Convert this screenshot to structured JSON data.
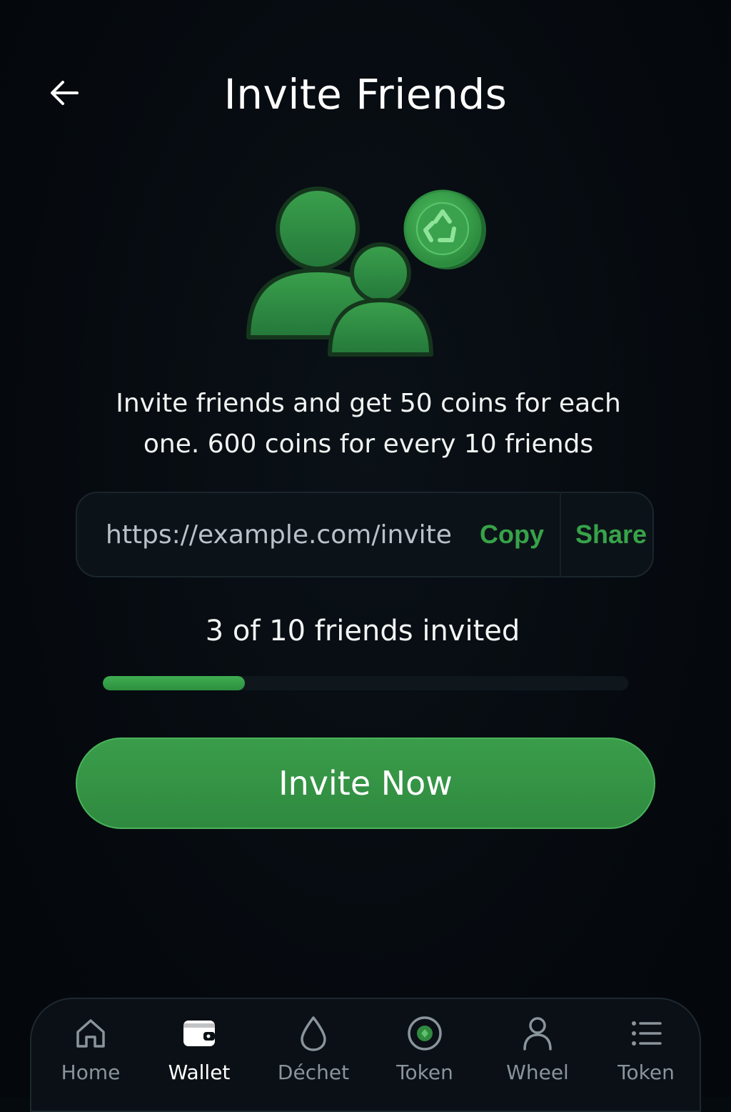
{
  "header": {
    "title": "Invite Friends",
    "back_icon": "arrow-left-icon"
  },
  "hero": {
    "icon": "friends-with-recycle-coin-icon",
    "accent_color": "#339a47"
  },
  "description": {
    "line1": "Invite friends and get 50 coins for each",
    "line2": "one. 600 coins for every 10 friends"
  },
  "invite_link": {
    "url": "https://example.com/invite",
    "copy_label": "Copy",
    "share_label": "Share"
  },
  "progress": {
    "label": "3 of 10 friends invited",
    "invited": 3,
    "goal": 10,
    "fraction": 0.27
  },
  "cta": {
    "label": "Invite Now"
  },
  "bottom_nav": {
    "items": [
      {
        "label": "Home",
        "icon": "home-icon",
        "active": false
      },
      {
        "label": "Wallet",
        "icon": "wallet-icon",
        "active": true
      },
      {
        "label": "Déchet",
        "icon": "drop-icon",
        "active": false
      },
      {
        "label": "Token",
        "icon": "coin-icon",
        "active": false
      },
      {
        "label": "Wheel",
        "icon": "user-icon",
        "active": false
      },
      {
        "label": "Token",
        "icon": "list-icon",
        "active": false
      }
    ]
  },
  "colors": {
    "background": "#05090e",
    "accent": "#37a349",
    "text": "#f2f5f3",
    "muted": "#8a949b"
  }
}
